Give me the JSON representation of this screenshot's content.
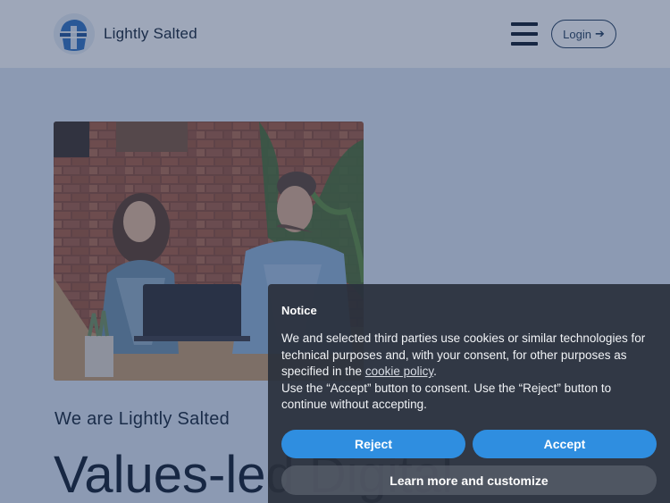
{
  "header": {
    "brand": "Lightly Salted",
    "login_label": "Login",
    "menu_icon": "hamburger-menu-icon",
    "login_icon": "arrow-right-icon"
  },
  "hero": {
    "kicker": "We are Lightly Salted",
    "headline": "Values-led Digital"
  },
  "cookie_notice": {
    "title": "Notice",
    "text_before_link": "We and selected third parties use cookies or similar technologies for technical purposes and, with your consent, for other purposes as specified in the ",
    "link_text": "cookie policy",
    "text_after_link": ".",
    "second_paragraph": "Use the “Accept” button to consent. Use the “Reject” button to continue without accepting.",
    "reject_label": "Reject",
    "accept_label": "Accept",
    "customize_label": "Learn more and customize"
  },
  "colors": {
    "page_background": "#dee8f4",
    "header_background": "#ffffff",
    "text_dark": "#0f2034",
    "button_blue": "#2f8ee0",
    "notice_background": "#2a303c"
  }
}
